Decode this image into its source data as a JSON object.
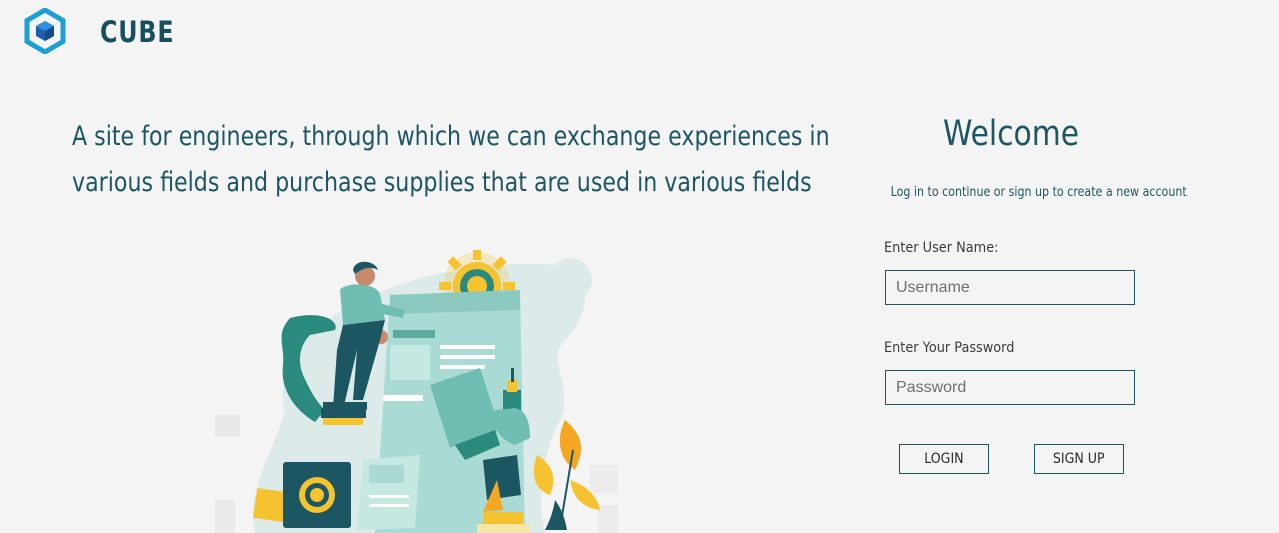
{
  "header": {
    "brand": "CUBE",
    "logo_icon": "cube-hexagon-icon"
  },
  "hero": {
    "tagline_line1": "A site for engineers, through which we can exchange experiences in",
    "tagline_line2": "various fields and purchase supplies that are used in various fields",
    "illustration": "engineer-illustration"
  },
  "login": {
    "title": "Welcome",
    "subtitle": "Log in to continue or sign up to create a new account",
    "username_label": "Enter User Name:",
    "username_placeholder": "Username",
    "username_value": "",
    "password_label": "Enter Your Password",
    "password_placeholder": "Password",
    "password_value": "",
    "login_button": "LOGIN",
    "signup_button": "SIGN UP"
  },
  "colors": {
    "background": "#f4f4f4",
    "primary": "#1d5663",
    "teal": "#2a8a7e",
    "light_teal": "#a9dad3",
    "accent_yellow": "#f5c230",
    "accent_orange": "#f5a623"
  }
}
